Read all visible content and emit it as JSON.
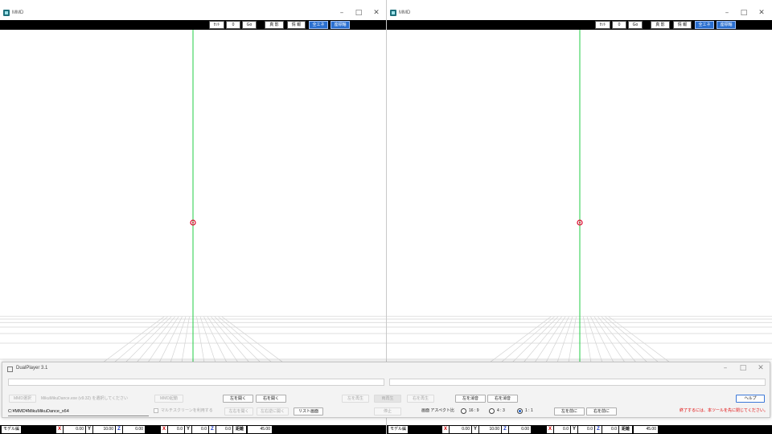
{
  "left_window": {
    "title": "MMD",
    "controls": {
      "minimize": "–",
      "maximize": "□",
      "close": "✕"
    },
    "toolbar": {
      "set_label": "ｾｯﾄ",
      "frame_value": "0",
      "go_label": "Go",
      "shadow_label": "真 影",
      "info_label": "情 報",
      "physics_label": "全エネ",
      "axis_label": "座標軸"
    },
    "status": {
      "mode": "モデル編",
      "pos_x": "0.00",
      "pos_y": "10.00",
      "pos_z": "0.00",
      "rot_x": "0.0",
      "rot_y": "0.0",
      "rot_z": "0.0",
      "distance_label": "距離",
      "distance_value": "45.00",
      "axis_x": "X",
      "axis_y": "Y",
      "axis_z": "Z"
    }
  },
  "right_window": {
    "title": "MMD",
    "controls": {
      "minimize": "–",
      "maximize": "□",
      "close": "✕"
    },
    "toolbar": {
      "set_label": "ｾｯﾄ",
      "frame_value": "0",
      "go_label": "Go",
      "shadow_label": "真 影",
      "info_label": "情 報",
      "physics_label": "全エネ",
      "axis_label": "座標軸"
    },
    "status": {
      "mode": "モデル編",
      "pos_x": "0.00",
      "pos_y": "10.00",
      "pos_z": "0.00",
      "rot_x": "0.0",
      "rot_y": "0.0",
      "rot_z": "0.0",
      "distance_label": "距離",
      "distance_value": "45.00",
      "axis_x": "X",
      "axis_y": "Y",
      "axis_z": "Z"
    }
  },
  "dualplayer": {
    "title": "DualPlayer 3.1",
    "controls": {
      "minimize": "–",
      "maximize": "□",
      "close": "✕"
    },
    "mmd_select": "MMD選択",
    "mmd_hint": "MikuMikuDance.exe (v9.32) を選択してください",
    "mmd_launch": "MMD起動",
    "open_left": "左を開く",
    "open_right": "右を開く",
    "play_left": "左を再生",
    "play_both": "両再生",
    "play_right": "右を再生",
    "mute_left": "左を消音",
    "mute_right": "右を消音",
    "help": "ヘルプ",
    "path_value": "C:¥MMD¥MikuMikuDance_x64",
    "multiscreen_label": "マルチスクリーンを利用する",
    "open_lr": "左右を開く",
    "open_lr_reverse": "左右逆に開く",
    "list_screen": "リスト画面",
    "stop": "停止",
    "aspect_label": "画面 アスペクト比",
    "aspect_options": [
      "16 : 9",
      "4 : 3",
      "1 : 1"
    ],
    "aspect_selected": "1 : 1",
    "left_front": "左を前に",
    "right_front": "右を前に",
    "exit_note": "終了するには、本ツールを先に閉じてください。"
  },
  "colors": {
    "axis_line": "#22cc44",
    "grid_line": "#d4d4d4",
    "center_marker": "#e0002a",
    "highlight_button": "#2a6fd0",
    "warning_text": "#e00000"
  }
}
